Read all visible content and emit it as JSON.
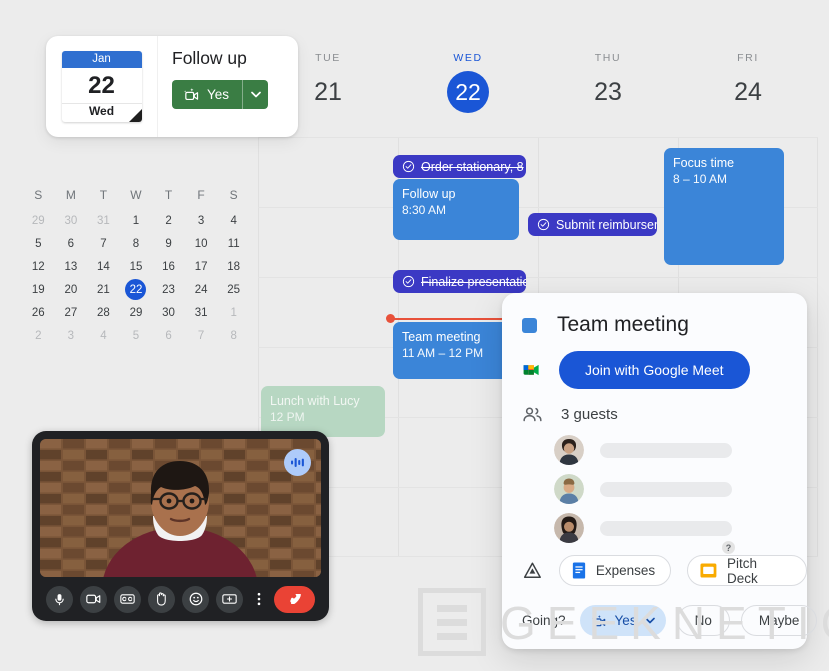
{
  "notification": {
    "date_chip": {
      "month": "Jan",
      "day": "22",
      "weekday": "Wed"
    },
    "title": "Follow up",
    "rsvp_button": "Yes",
    "rsvp_icon": "video-camera-sparkle-icon",
    "caret_icon": "chevron-down-icon"
  },
  "week_header": [
    {
      "dow": "TUE",
      "num": "21",
      "active": false
    },
    {
      "dow": "WED",
      "num": "22",
      "active": true
    },
    {
      "dow": "THU",
      "num": "23",
      "active": false
    },
    {
      "dow": "FRI",
      "num": "24",
      "active": false
    }
  ],
  "mini_calendar": {
    "weekday_labels": [
      "S",
      "M",
      "T",
      "W",
      "T",
      "F",
      "S"
    ],
    "weeks": [
      [
        {
          "d": "29",
          "dim": true
        },
        {
          "d": "30",
          "dim": true
        },
        {
          "d": "31",
          "dim": true
        },
        {
          "d": "1"
        },
        {
          "d": "2"
        },
        {
          "d": "3"
        },
        {
          "d": "4"
        }
      ],
      [
        {
          "d": "5"
        },
        {
          "d": "6"
        },
        {
          "d": "7"
        },
        {
          "d": "8"
        },
        {
          "d": "9"
        },
        {
          "d": "10"
        },
        {
          "d": "11"
        }
      ],
      [
        {
          "d": "12"
        },
        {
          "d": "13"
        },
        {
          "d": "14"
        },
        {
          "d": "15"
        },
        {
          "d": "16"
        },
        {
          "d": "17"
        },
        {
          "d": "18"
        }
      ],
      [
        {
          "d": "19"
        },
        {
          "d": "20"
        },
        {
          "d": "21"
        },
        {
          "d": "22",
          "today": true
        },
        {
          "d": "23"
        },
        {
          "d": "24"
        },
        {
          "d": "25"
        }
      ],
      [
        {
          "d": "26"
        },
        {
          "d": "27"
        },
        {
          "d": "28"
        },
        {
          "d": "29"
        },
        {
          "d": "30"
        },
        {
          "d": "31"
        },
        {
          "d": "1",
          "dim": true
        }
      ],
      [
        {
          "d": "2",
          "dim": true
        },
        {
          "d": "3",
          "dim": true
        },
        {
          "d": "4",
          "dim": true
        },
        {
          "d": "5",
          "dim": true
        },
        {
          "d": "6",
          "dim": true
        },
        {
          "d": "7",
          "dim": true
        },
        {
          "d": "8",
          "dim": true
        }
      ]
    ]
  },
  "events": {
    "order_stationary": {
      "label": "Order stationary, 8",
      "completed": true
    },
    "follow_up": {
      "title": "Follow up",
      "time": "8:30 AM"
    },
    "finalize_presentation": {
      "label": "Finalize presentatio",
      "completed": true
    },
    "submit_reimbursement": {
      "label": "Submit reimbursem",
      "completed": false
    },
    "team_meeting": {
      "title": "Team meeting",
      "time": "11 AM – 12 PM"
    },
    "focus_time": {
      "title": "Focus time",
      "time": "8 – 10 AM"
    },
    "lunch_with_lucy": {
      "title": "Lunch with Lucy",
      "time": "12 PM"
    }
  },
  "popup": {
    "title": "Team meeting",
    "meet_button": "Join with Google Meet",
    "guests_label": "3 guests",
    "guests": [
      {
        "status": "accepted",
        "badge": "✓"
      },
      {
        "status": "accepted",
        "badge": "✓"
      },
      {
        "status": "unknown",
        "badge": "?"
      }
    ],
    "attachments": [
      {
        "label": "Expenses",
        "icon": "google-docs-icon"
      },
      {
        "label": "Pitch Deck",
        "icon": "google-slides-icon"
      }
    ],
    "drive_icon": "google-drive-icon",
    "rsvp": {
      "prompt": "Going?",
      "yes": "Yes",
      "no": "No",
      "maybe": "Maybe"
    }
  },
  "video_call": {
    "audio_indicator": "audio-waveform-icon",
    "controls": [
      {
        "name": "microphone-button",
        "icon": "microphone-icon"
      },
      {
        "name": "camera-button",
        "icon": "video-camera-icon"
      },
      {
        "name": "captions-button",
        "icon": "closed-captions-icon"
      },
      {
        "name": "raise-hand-button",
        "icon": "raised-hand-icon"
      },
      {
        "name": "reactions-button",
        "icon": "emoji-smiley-icon"
      },
      {
        "name": "present-button",
        "icon": "present-screen-icon"
      },
      {
        "name": "more-options-button",
        "icon": "more-vertical-icon"
      },
      {
        "name": "hang-up-button",
        "icon": "phone-hangup-icon"
      }
    ]
  },
  "watermark": {
    "text": "GEEKNETIC"
  },
  "colors": {
    "accent_blue": "#1a56d6",
    "event_blue": "#3b85d8",
    "task_indigo": "#3b39c4",
    "event_green": "#b7d7c2",
    "rsvp_green": "#3a7d44",
    "now_red": "#e8513a",
    "hangup_red": "#ea4335"
  }
}
